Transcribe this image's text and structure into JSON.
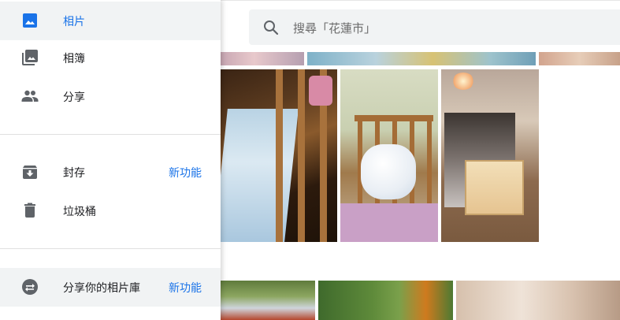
{
  "search": {
    "placeholder": "搜尋「花蓮市」",
    "icon": "search-icon"
  },
  "drawer": {
    "items": [
      {
        "label": "相片",
        "icon": "photo-icon",
        "active": true
      },
      {
        "label": "相簿",
        "icon": "albums-icon"
      },
      {
        "label": "分享",
        "icon": "people-icon"
      },
      {
        "label": "封存",
        "icon": "archive-icon",
        "badge": "新功能"
      },
      {
        "label": "垃圾桶",
        "icon": "trash-icon"
      },
      {
        "label": "分享你的相片庫",
        "icon": "swap-icon",
        "badge": "新功能"
      }
    ]
  },
  "colors": {
    "accent": "#1a73e8",
    "icon": "#5f6368",
    "highlight": "#f1f3f4"
  }
}
